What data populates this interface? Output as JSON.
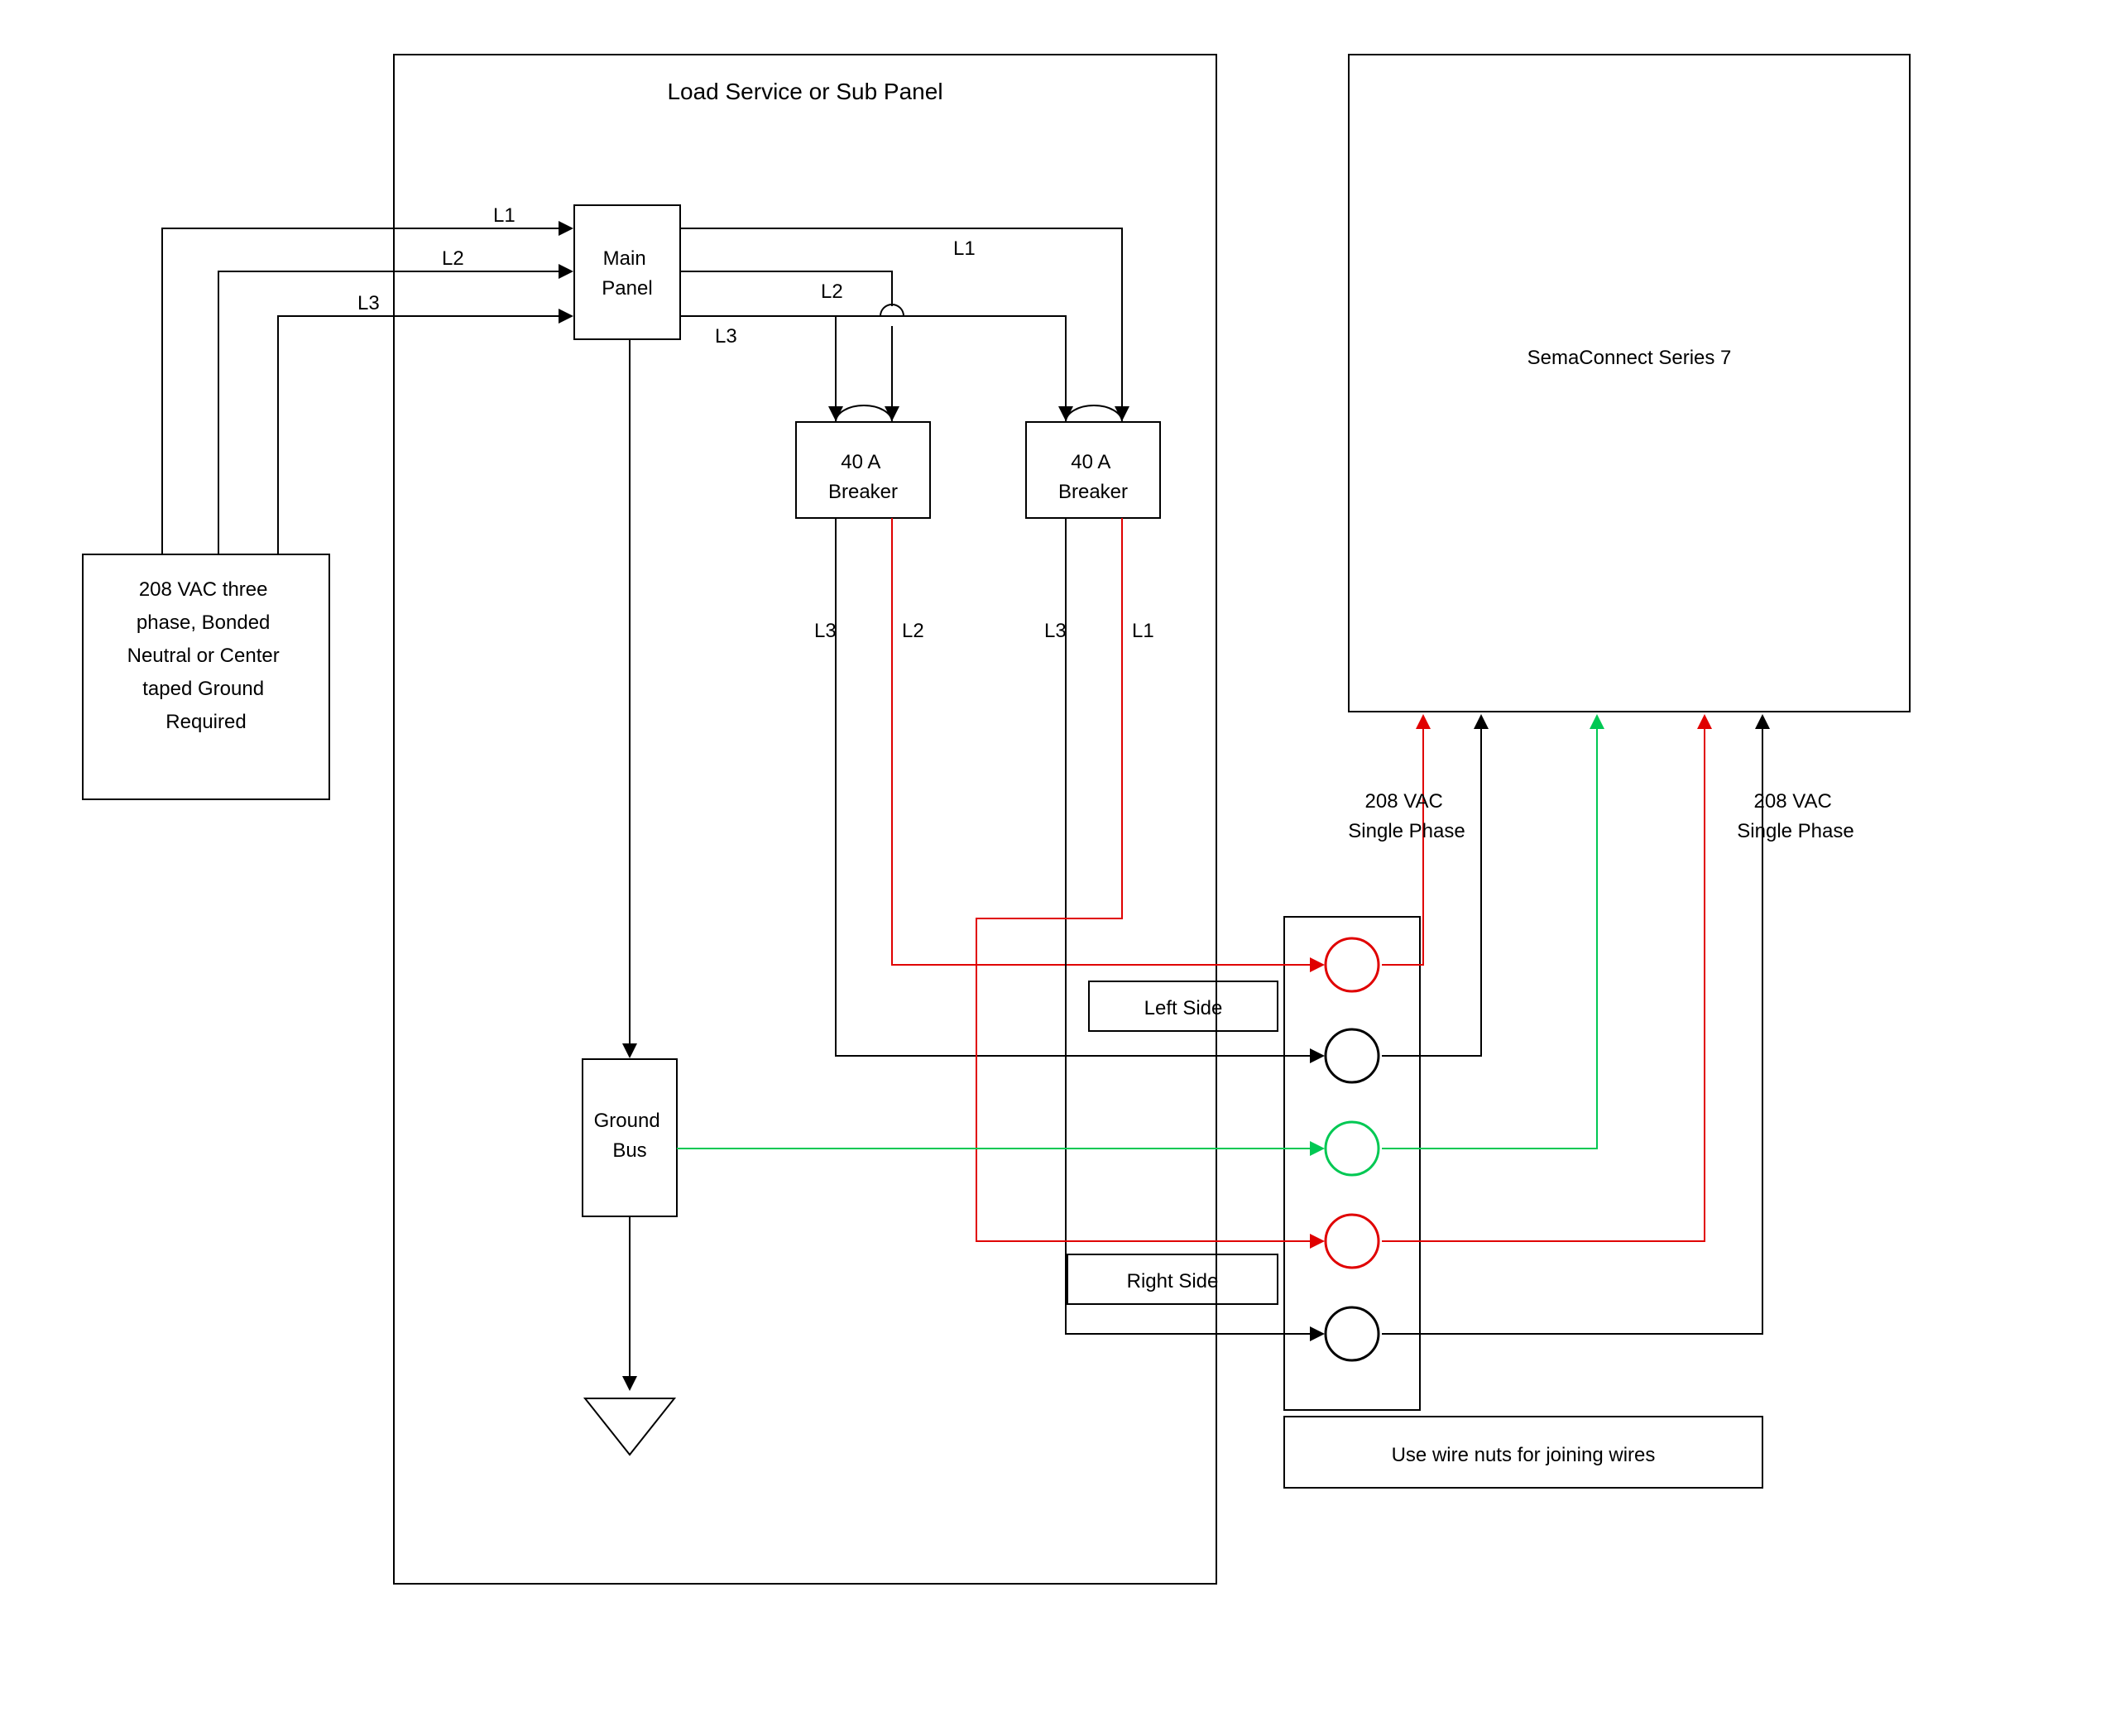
{
  "diagram": {
    "panel_title": "Load Service or Sub Panel",
    "source_box": "208 VAC three phase, Bonded Neutral or Center taped Ground Required",
    "main_panel": "Main Panel",
    "breaker_label_line1": "40 A",
    "breaker_label_line2": "Breaker",
    "ground_bus_line1": "Ground",
    "ground_bus_line2": "Bus",
    "semaconnect": "SemaConnect Series 7",
    "left_side": "Left Side",
    "right_side": "Right Side",
    "voltage_label_line1": "208 VAC",
    "voltage_label_line2": "Single Phase",
    "wire_nuts": "Use wire nuts for joining wires",
    "L1": "L1",
    "L2": "L2",
    "L3": "L3"
  }
}
